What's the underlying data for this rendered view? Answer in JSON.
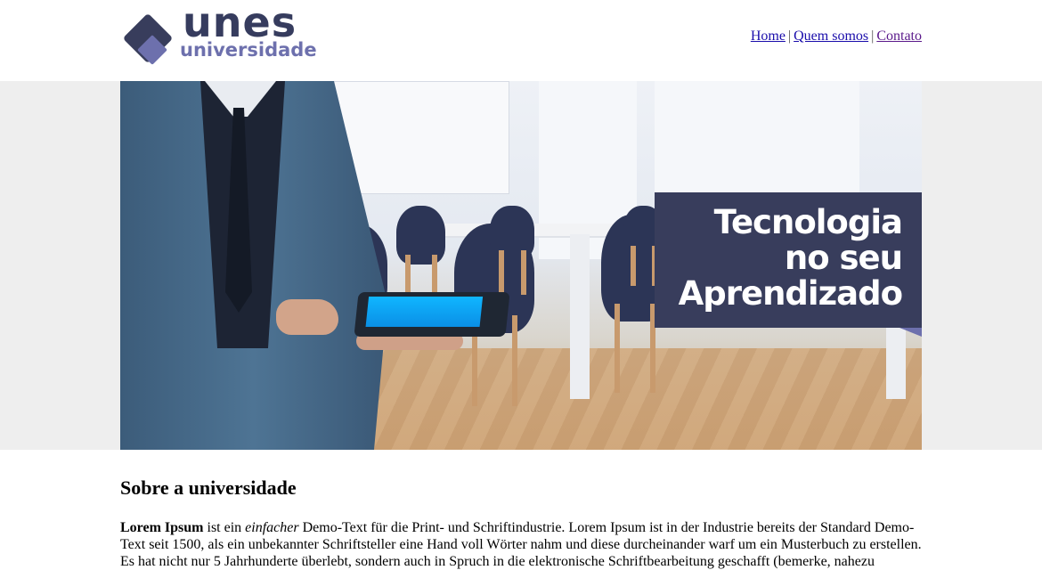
{
  "brand": {
    "name_line_1": "unes",
    "name_line_2": "universidade",
    "colors": {
      "primary": "#383d5c",
      "accent": "#6d70ad"
    },
    "logo_icon": "diamond-logo-icon"
  },
  "nav": {
    "items": [
      {
        "label": "Home"
      },
      {
        "label": "Quem somos"
      },
      {
        "label": "Contato"
      }
    ],
    "separator": "|"
  },
  "banner": {
    "headline_line_1": "Tecnologia",
    "headline_line_2": "no seu",
    "headline_line_3": "Aprendizado",
    "band_color": "#eeeeee"
  },
  "about": {
    "heading": "Sobre a universidade",
    "para_bold": "Lorem Ipsum",
    "para_t1": " ist ein ",
    "para_italic": "einfacher",
    "para_t2": " Demo-Text für die Print- und Schriftindustrie. Lorem Ipsum ist in der Industrie bereits der Standard Demo-Text seit 1500, als ein unbekannter Schriftsteller eine Hand voll Wörter nahm und diese durcheinander warf um ein Musterbuch zu erstellen. Es hat nicht nur 5 Jahrhunderte überlebt, sondern auch in Spruch in die elektronische Schriftbearbeitung geschafft (bemerke, nahezu"
  }
}
